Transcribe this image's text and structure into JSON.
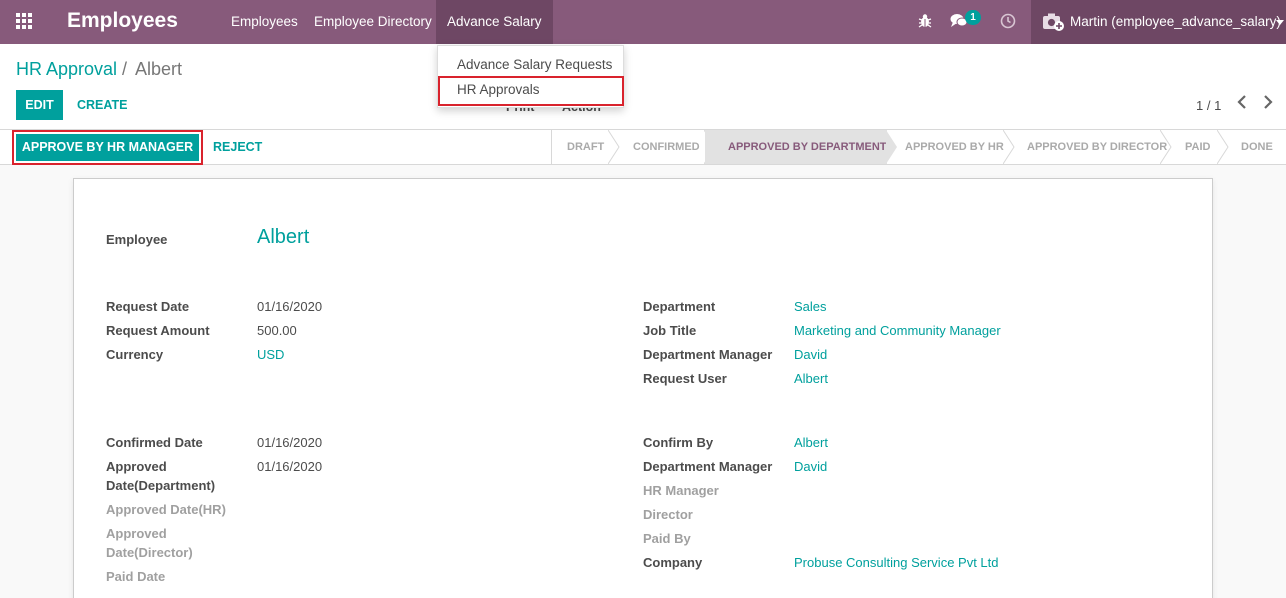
{
  "navbar": {
    "app_title": "Employees",
    "menu": [
      "Employees",
      "Employee Directory",
      "Advance Salary"
    ],
    "chat_count": "1",
    "user": "Martin (employee_advance_salary)",
    "bg_color": "#875a7b"
  },
  "dropdown": {
    "items": [
      "Advance Salary Requests",
      "HR Approvals"
    ]
  },
  "breadcrumb": {
    "parent": "HR Approval",
    "separator": "/",
    "current": "Albert"
  },
  "buttons": {
    "edit": "EDIT",
    "create": "CREATE",
    "print_hidden": "Print",
    "action_hidden": "Action",
    "approve": "APPROVE BY HR MANAGER",
    "reject": "REJECT"
  },
  "pager": {
    "value": "1 / 1"
  },
  "stages": [
    {
      "label": "DRAFT"
    },
    {
      "label": "CONFIRMED"
    },
    {
      "label": "APPROVED BY DEPARTMENT",
      "current": true
    },
    {
      "label": "APPROVED BY HR"
    },
    {
      "label": "APPROVED BY DIRECTOR"
    },
    {
      "label": "PAID"
    },
    {
      "label": "DONE"
    }
  ],
  "form": {
    "employee_label": "Employee",
    "employee_value": "Albert",
    "left": [
      {
        "label": "Request Date",
        "value": "01/16/2020"
      },
      {
        "label": "Request Amount",
        "value": "500.00"
      },
      {
        "label": "Currency",
        "value": "USD"
      }
    ],
    "right": [
      {
        "label": "Department",
        "value": "Sales"
      },
      {
        "label": "Job Title",
        "value": "Marketing and Community Manager"
      },
      {
        "label": "Department Manager",
        "value": "David"
      },
      {
        "label": "Request User",
        "value": "Albert"
      }
    ],
    "left2": [
      {
        "label": "Confirmed Date",
        "value": "01/16/2020"
      },
      {
        "label_line1": "Approved",
        "label_line2": "Date(Department)",
        "value": "01/16/2020"
      },
      {
        "label_line1": "Approved Date(HR)",
        "value": ""
      },
      {
        "label_line1": "Approved",
        "label_line2": "Date(Director)",
        "value": ""
      },
      {
        "label_line1": "Paid Date",
        "value": ""
      }
    ],
    "right2": [
      {
        "label": "Confirm By",
        "value": "Albert"
      },
      {
        "label": "Department Manager",
        "value": "David"
      },
      {
        "label": "HR Manager",
        "value": ""
      },
      {
        "label": "Director",
        "value": ""
      },
      {
        "label": "Paid By",
        "value": ""
      },
      {
        "label": "Company",
        "value": "Probuse Consulting Service Pvt Ltd"
      }
    ]
  }
}
